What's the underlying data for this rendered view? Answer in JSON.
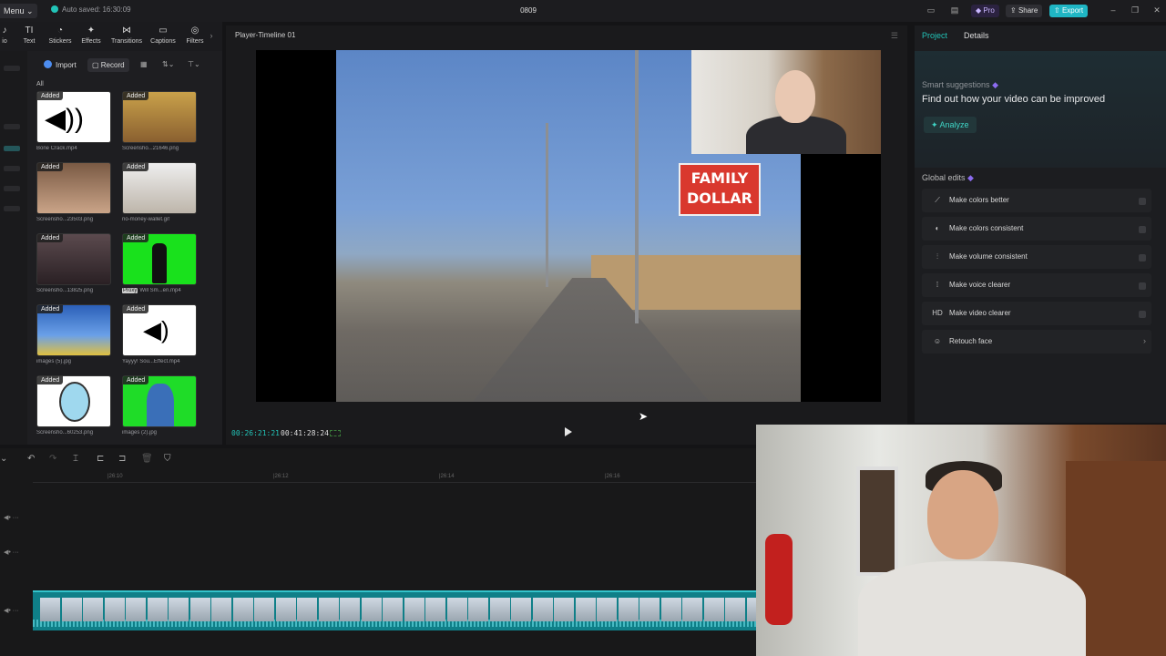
{
  "titlebar": {
    "menu": "Menu",
    "autosave": "Auto saved: 16:30:09",
    "project_name": "0809",
    "pro": "Pro",
    "share": "Share",
    "export": "Export"
  },
  "toolbar": [
    {
      "label": "Text",
      "icon": "text-icon"
    },
    {
      "label": "Stickers",
      "icon": "sticker-icon"
    },
    {
      "label": "Effects",
      "icon": "effects-icon"
    },
    {
      "label": "Transitions",
      "icon": "transitions-icon"
    },
    {
      "label": "Captions",
      "icon": "captions-icon"
    },
    {
      "label": "Filters",
      "icon": "filters-icon"
    }
  ],
  "media": {
    "import": "Import",
    "record": "Record",
    "all": "All",
    "items": [
      {
        "badge": "Added",
        "name": "Bone Crack.mp4"
      },
      {
        "badge": "Added",
        "name": "Screensho...21646.png"
      },
      {
        "badge": "Added",
        "name": "Screensho...23503.png"
      },
      {
        "badge": "Added",
        "name": "no-money-wallet.gif"
      },
      {
        "badge": "Added",
        "name": "Screensho...13825.png"
      },
      {
        "badge": "Added",
        "name": "Will Sm...en.mp4",
        "proxy": "Proxy"
      },
      {
        "badge": "Added",
        "name": "images (5).jpg"
      },
      {
        "badge": "Added",
        "name": "Yayyy! Sou...Effect.mp4"
      },
      {
        "badge": "Added",
        "name": "Screensho...60253.png"
      },
      {
        "badge": "Added",
        "name": "images (2).jpg"
      }
    ]
  },
  "player": {
    "title": "Player-Timeline 01",
    "sign_text": "FAMILY DOLLAR",
    "current_time": "00:26:21:21",
    "total_time": "00:41:28:24"
  },
  "right_panel": {
    "tabs": [
      "Project",
      "Details"
    ],
    "smart_suggestions": "Smart suggestions",
    "suggest_title": "Find out how your video can be improved",
    "analyze": "Analyze",
    "global_edits": "Global edits",
    "edits": [
      {
        "label": "Make colors better",
        "icon": "wand-icon",
        "control": "toggle"
      },
      {
        "label": "Make colors consistent",
        "icon": "palette-icon",
        "control": "toggle"
      },
      {
        "label": "Make volume consistent",
        "icon": "volume-bars-icon",
        "control": "toggle"
      },
      {
        "label": "Make voice clearer",
        "icon": "voice-icon",
        "control": "toggle"
      },
      {
        "label": "Make video clearer",
        "icon": "hd-icon",
        "control": "toggle"
      },
      {
        "label": "Retouch face",
        "icon": "face-icon",
        "control": "chevron"
      }
    ]
  },
  "timeline": {
    "ticks": [
      "|26:10",
      "|26:12",
      "|26:14",
      "|26:16"
    ]
  },
  "colors": {
    "accent": "#22c4b8",
    "export": "#1fb6c4",
    "pro": "#7b4ee4",
    "clip": "#0f7f88"
  }
}
